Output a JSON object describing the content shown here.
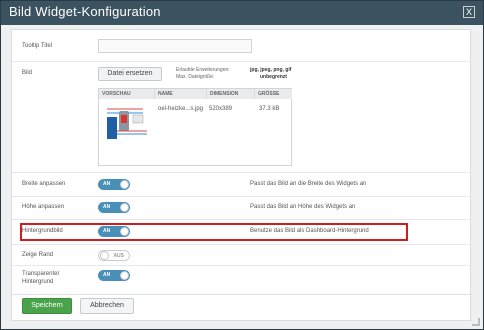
{
  "dialog": {
    "title": "Bild Widget-Konfiguration",
    "close_label": "X"
  },
  "fields": {
    "tooltip_label": "Tooltip Titel",
    "tooltip_value": "",
    "bild_label": "Bild",
    "replace_button": "Datei ersetzen",
    "allowed_ext_label": "Erlaubte Erweiterungen:",
    "allowed_ext_value": "jpg, jpeg, png, gif",
    "max_size_label": "Max. Dateigröße:",
    "max_size_value": "unbegrenzt"
  },
  "file_table": {
    "headers": [
      "VORSCHAU",
      "NAME",
      "DIMENSION",
      "GRÖSSE"
    ],
    "row": {
      "name": "oel-heizke...s.jpg",
      "dimension": "520x389",
      "size": "37.3 kB"
    }
  },
  "settings": [
    {
      "label": "Breite anpassen",
      "state": "AN",
      "on": true,
      "desc": "Passt das Bild an die Breite des Widgets an"
    },
    {
      "label": "Höhe anpassen",
      "state": "AN",
      "on": true,
      "desc": "Passt das Bild an Höhe des Widgets an"
    },
    {
      "label": "Hintergrundbild",
      "state": "AN",
      "on": true,
      "desc": "Benutze das Bild als Dashboard-Hintergrund"
    },
    {
      "label": "Zeige Rand",
      "state": "AUS",
      "on": false,
      "desc": ""
    },
    {
      "label": "Transparenter",
      "label2": "Hintergrund",
      "state": "AN",
      "on": true,
      "desc": ""
    }
  ],
  "footer": {
    "save": "Speichern",
    "cancel": "Abbrechen"
  },
  "colors": {
    "titlebar": "#3b5360",
    "toggle_on": "#4a8fb8",
    "save_button": "#4aa34a",
    "highlight": "#cc1f1f"
  }
}
